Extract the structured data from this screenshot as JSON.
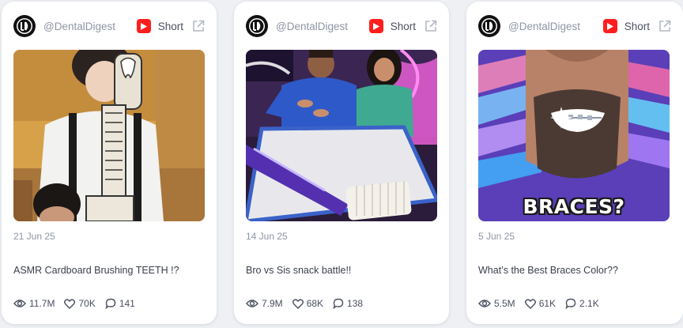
{
  "cards": [
    {
      "handle": "@DentalDigest",
      "type": "Short",
      "date": "21 Jun 25",
      "title": "ASMR Cardboard Brushing TEETH !?",
      "views": "11.7M",
      "likes": "70K",
      "comments": "141"
    },
    {
      "handle": "@DentalDigest",
      "type": "Short",
      "date": "14 Jun 25",
      "title": "Bro vs Sis snack battle!!",
      "views": "7.9M",
      "likes": "68K",
      "comments": "138"
    },
    {
      "handle": "@DentalDigest",
      "type": "Short",
      "date": "5 Jun 25",
      "title": "What’s the Best Braces Color??",
      "views": "5.5M",
      "likes": "61K",
      "comments": "2.1K",
      "thumbnail_caption": "BRACES?"
    }
  ],
  "colors": {
    "youtube_red": "#ff1e1e",
    "muted_text": "#8e95a3",
    "body_text": "#3a3f4b"
  },
  "icons": {
    "avatar": "dd-logo",
    "platform": "youtube-icon",
    "external": "external-link-icon",
    "views": "eye-icon",
    "likes": "heart-icon",
    "comments": "comment-icon"
  }
}
